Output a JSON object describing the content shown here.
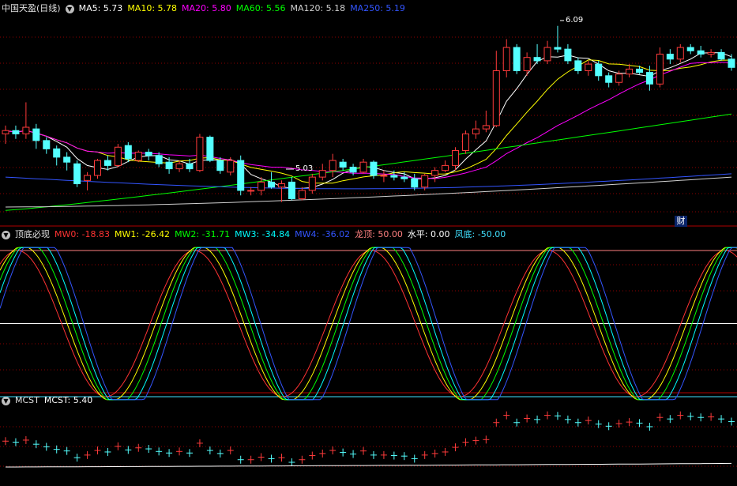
{
  "main_panel": {
    "title": "中国天盈(日线)",
    "indicators": [
      {
        "label": "MA5: 5.73",
        "color": "#ffffff"
      },
      {
        "label": "MA10: 5.78",
        "color": "#ffff00"
      },
      {
        "label": "MA20: 5.80",
        "color": "#ff00ff"
      },
      {
        "label": "MA60: 5.56",
        "color": "#00ff00"
      },
      {
        "label": "MA120: 5.18",
        "color": "#d0d0d0"
      },
      {
        "label": "MA250: 5.19",
        "color": "#3355ff"
      }
    ],
    "high_annotation": "6.09",
    "low_annotation": "5.03",
    "badge": "财"
  },
  "oscillator_panel": {
    "title": "顶底必现",
    "indicators": [
      {
        "label": "MW0: -18.83",
        "color": "#ff3333"
      },
      {
        "label": "MW1: -26.42",
        "color": "#ffff00"
      },
      {
        "label": "MW2: -31.71",
        "color": "#00ff00"
      },
      {
        "label": "MW3: -34.84",
        "color": "#00ffff"
      },
      {
        "label": "MW4: -36.02",
        "color": "#3355ff"
      },
      {
        "label": "龙顶: 50.00",
        "color": "#ff8080"
      },
      {
        "label": "水平: 0.00",
        "color": "#ffffff"
      },
      {
        "label": "凤底: -50.00",
        "color": "#40e0ff"
      }
    ]
  },
  "mcst_panel": {
    "title": "MCST",
    "indicators": [
      {
        "label": "MCST: 5.40",
        "color": "#ffffff"
      }
    ]
  },
  "colors": {
    "up": "#ff3b3b",
    "down": "#54ffff",
    "grid": "#8b0000",
    "separator": "#b00000"
  },
  "chart_data": {
    "type": "candlestick",
    "candles": [
      [
        5.44,
        5.49,
        5.38,
        5.46
      ],
      [
        5.46,
        5.49,
        5.41,
        5.44
      ],
      [
        5.44,
        5.63,
        5.41,
        5.48
      ],
      [
        5.47,
        5.5,
        5.35,
        5.4
      ],
      [
        5.4,
        5.42,
        5.32,
        5.35
      ],
      [
        5.35,
        5.37,
        5.25,
        5.3
      ],
      [
        5.3,
        5.33,
        5.22,
        5.27
      ],
      [
        5.26,
        5.28,
        5.12,
        5.14
      ],
      [
        5.16,
        5.21,
        5.1,
        5.19
      ],
      [
        5.19,
        5.29,
        5.17,
        5.28
      ],
      [
        5.28,
        5.31,
        5.22,
        5.25
      ],
      [
        5.25,
        5.38,
        5.24,
        5.36
      ],
      [
        5.37,
        5.39,
        5.27,
        5.29
      ],
      [
        5.28,
        5.34,
        5.27,
        5.33
      ],
      [
        5.33,
        5.35,
        5.28,
        5.31
      ],
      [
        5.31,
        5.33,
        5.24,
        5.26
      ],
      [
        5.27,
        5.3,
        5.2,
        5.23
      ],
      [
        5.23,
        5.28,
        5.21,
        5.26
      ],
      [
        5.26,
        5.29,
        5.21,
        5.23
      ],
      [
        5.22,
        5.44,
        5.21,
        5.42
      ],
      [
        5.42,
        5.43,
        5.27,
        5.28
      ],
      [
        5.28,
        5.3,
        5.2,
        5.22
      ],
      [
        5.21,
        5.3,
        5.19,
        5.28
      ],
      [
        5.28,
        5.31,
        5.07,
        5.1
      ],
      [
        5.1,
        5.12,
        5.07,
        5.1
      ],
      [
        5.1,
        5.18,
        5.07,
        5.15
      ],
      [
        5.15,
        5.21,
        5.11,
        5.12
      ],
      [
        5.12,
        5.16,
        5.03,
        5.14
      ],
      [
        5.15,
        5.18,
        5.04,
        5.05
      ],
      [
        5.05,
        5.12,
        5.04,
        5.1
      ],
      [
        5.1,
        5.2,
        5.08,
        5.18
      ],
      [
        5.18,
        5.26,
        5.16,
        5.22
      ],
      [
        5.22,
        5.32,
        5.18,
        5.28
      ],
      [
        5.27,
        5.29,
        5.22,
        5.24
      ],
      [
        5.24,
        5.26,
        5.19,
        5.21
      ],
      [
        5.21,
        5.29,
        5.2,
        5.27
      ],
      [
        5.27,
        5.28,
        5.17,
        5.19
      ],
      [
        5.19,
        5.22,
        5.15,
        5.19
      ],
      [
        5.19,
        5.22,
        5.16,
        5.18
      ],
      [
        5.18,
        5.21,
        5.15,
        5.17
      ],
      [
        5.17,
        5.2,
        5.1,
        5.12
      ],
      [
        5.12,
        5.2,
        5.1,
        5.19
      ],
      [
        5.19,
        5.24,
        5.15,
        5.22
      ],
      [
        5.22,
        5.28,
        5.21,
        5.25
      ],
      [
        5.25,
        5.36,
        5.22,
        5.34
      ],
      [
        5.34,
        5.46,
        5.32,
        5.44
      ],
      [
        5.44,
        5.52,
        5.41,
        5.47
      ],
      [
        5.47,
        5.58,
        5.45,
        5.49
      ],
      [
        5.49,
        5.94,
        5.48,
        5.82
      ],
      [
        5.82,
        6.01,
        5.78,
        5.96
      ],
      [
        5.96,
        5.98,
        5.8,
        5.82
      ],
      [
        5.82,
        5.93,
        5.79,
        5.9
      ],
      [
        5.9,
        5.98,
        5.86,
        5.88
      ],
      [
        5.88,
        6.0,
        5.86,
        5.96
      ],
      [
        5.96,
        6.09,
        5.93,
        5.95
      ],
      [
        5.95,
        5.98,
        5.86,
        5.88
      ],
      [
        5.88,
        5.9,
        5.8,
        5.82
      ],
      [
        5.82,
        5.88,
        5.79,
        5.86
      ],
      [
        5.86,
        5.88,
        5.76,
        5.79
      ],
      [
        5.79,
        5.81,
        5.72,
        5.75
      ],
      [
        5.75,
        5.82,
        5.73,
        5.8
      ],
      [
        5.8,
        5.86,
        5.78,
        5.83
      ],
      [
        5.83,
        5.85,
        5.8,
        5.81
      ],
      [
        5.81,
        5.85,
        5.7,
        5.74
      ],
      [
        5.74,
        5.96,
        5.72,
        5.92
      ],
      [
        5.92,
        5.95,
        5.86,
        5.89
      ],
      [
        5.89,
        5.98,
        5.87,
        5.96
      ],
      [
        5.96,
        5.98,
        5.92,
        5.94
      ],
      [
        5.94,
        5.97,
        5.9,
        5.92
      ],
      [
        5.92,
        5.95,
        5.9,
        5.93
      ],
      [
        5.93,
        5.95,
        5.88,
        5.89
      ],
      [
        5.89,
        5.92,
        5.82,
        5.84
      ]
    ],
    "y_range": [
      4.9,
      6.16
    ]
  }
}
